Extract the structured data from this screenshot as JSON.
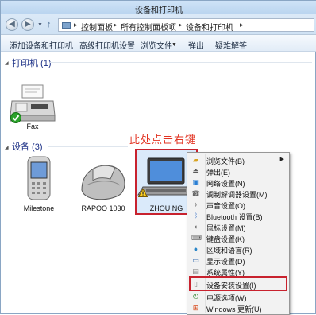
{
  "window": {
    "title": "设备和打印机",
    "breadcrumbs": [
      "控制面板",
      "所有控制面板项",
      "设备和打印机"
    ]
  },
  "toolbar": {
    "add_device": "添加设备和打印机",
    "print_server": "高级打印机设置",
    "browse_files": "浏览文件",
    "eject": "弹出",
    "troubleshoot": "疑难解答"
  },
  "printers": {
    "header": "打印机 (1)",
    "items": [
      {
        "label": "Fax"
      }
    ]
  },
  "devices": {
    "header": "设备 (3)",
    "items": [
      {
        "label": "Milestone"
      },
      {
        "label": "RAPOO 1030"
      },
      {
        "label": "ZHOUING"
      }
    ]
  },
  "annotation": "此处点击右键",
  "context_menu": {
    "items": [
      {
        "label": "浏览文件(B)",
        "icon": "folder-icon",
        "submenu": true
      },
      {
        "label": "弹出(E)",
        "icon": "eject-icon"
      },
      {
        "label": "网络设置(N)",
        "icon": "network-icon"
      },
      {
        "label": "调制解调器设置(M)",
        "icon": "modem-icon"
      },
      {
        "label": "声音设置(O)",
        "icon": "sound-icon"
      },
      {
        "label": "Bluetooth 设置(B)",
        "icon": "bluetooth-icon"
      },
      {
        "label": "鼠标设置(M)",
        "icon": "mouse-icon"
      },
      {
        "label": "键盘设置(K)",
        "icon": "keyboard-icon"
      },
      {
        "label": "区域和语言(R)",
        "icon": "globe-icon"
      },
      {
        "label": "显示设置(D)",
        "icon": "display-icon"
      },
      {
        "label": "系统属性(Y)",
        "icon": "system-icon"
      },
      {
        "label": "设备安装设置(I)",
        "icon": "install-icon",
        "highlighted": true
      },
      {
        "label": "电源选项(W)",
        "icon": "power-icon"
      },
      {
        "label": "Windows 更新(U)",
        "icon": "update-icon"
      }
    ]
  },
  "colors": {
    "annotation_red": "#e23322",
    "highlight_border": "#c8222e",
    "section_header": "#1e3287"
  }
}
